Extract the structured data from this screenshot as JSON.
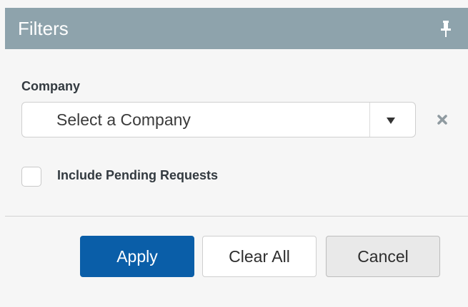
{
  "header": {
    "title": "Filters",
    "pin_icon": "pin-icon",
    "bg_color": "#8ea3ac"
  },
  "company": {
    "label": "Company",
    "selected_value": "Select a Company",
    "dropdown_icon": "chevron-down-icon",
    "clear_icon": "clear-x-icon"
  },
  "pending": {
    "label": "Include Pending Requests",
    "checked": false
  },
  "actions": {
    "apply_label": "Apply",
    "clear_label": "Clear All",
    "cancel_label": "Cancel",
    "primary_color": "#0a5ea8"
  }
}
